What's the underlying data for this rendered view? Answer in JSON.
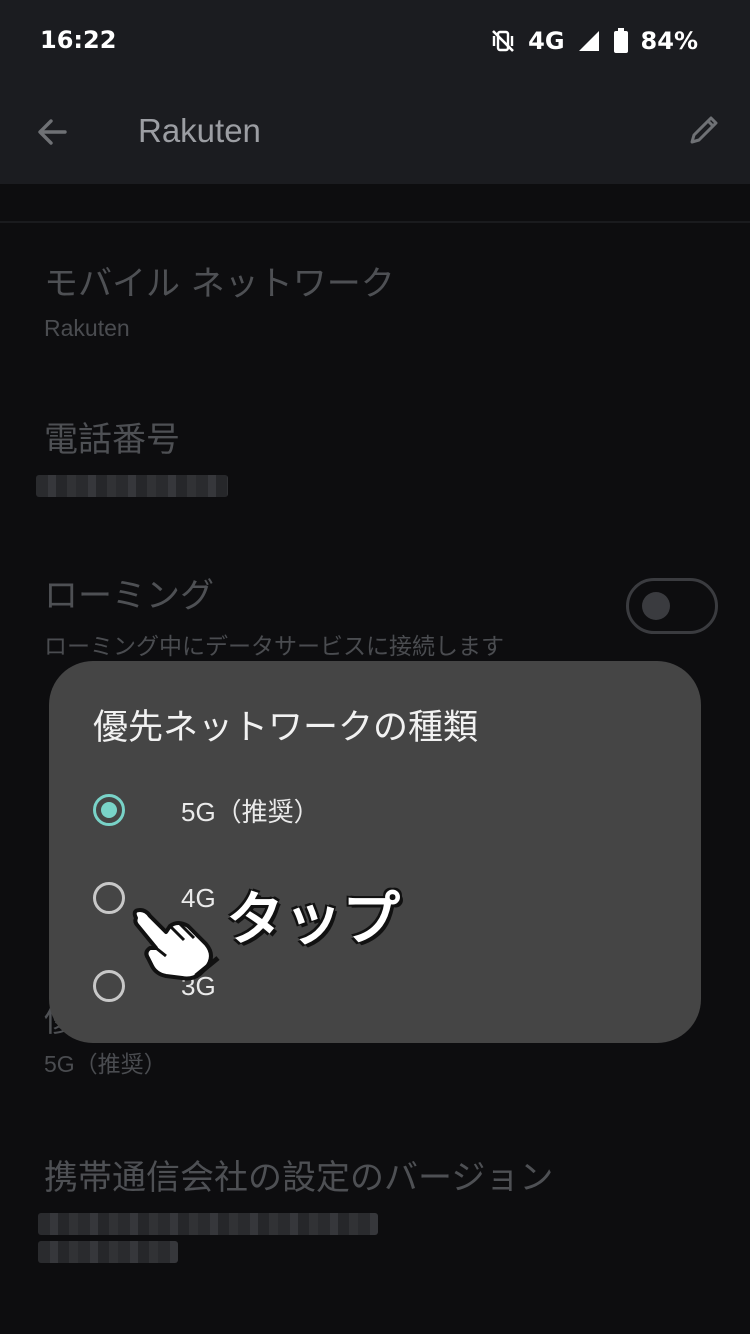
{
  "status_bar": {
    "time": "16:22",
    "network": "4G",
    "battery": "84%"
  },
  "app_bar": {
    "title": "Rakuten"
  },
  "settings": [
    {
      "title": "モバイル ネットワーク",
      "subtitle": "Rakuten"
    },
    {
      "title": "電話番号",
      "subtitle": ""
    },
    {
      "title": "ローミング",
      "subtitle": "ローミング中にデータサービスに接続します",
      "toggle_on": false
    },
    {
      "title": "優",
      "subtitle": "5G（推奨）"
    },
    {
      "title": "携帯通信会社の設定のバージョン",
      "subtitle": ""
    }
  ],
  "dialog": {
    "title": "優先ネットワークの種類",
    "options": [
      {
        "label": "5G（推奨）",
        "selected": true
      },
      {
        "label": "4G",
        "selected": false
      },
      {
        "label": "3G",
        "selected": false
      }
    ]
  },
  "annotation": {
    "tap_label": "タップ"
  },
  "colors": {
    "accent": "#79d3c8",
    "dialog_bg": "#454545",
    "app_bar_bg": "#1b1c20"
  }
}
